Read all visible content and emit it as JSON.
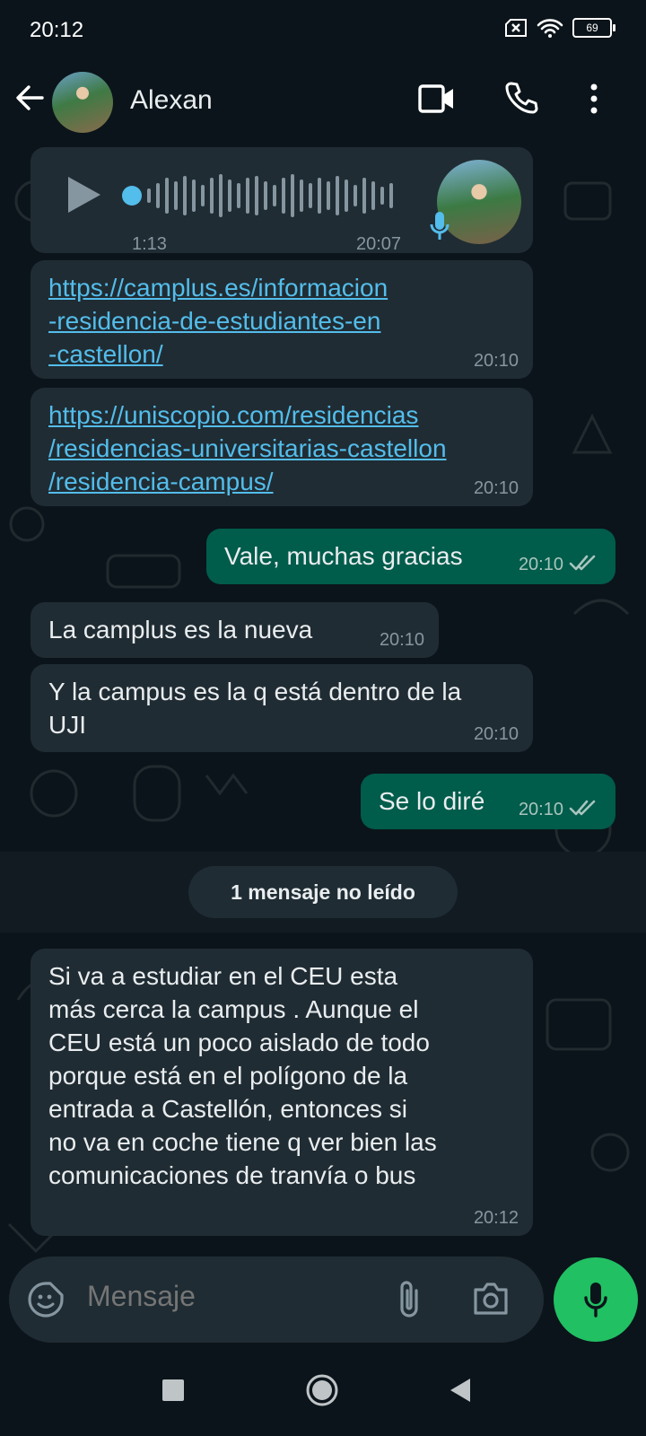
{
  "status_bar": {
    "time": "20:12",
    "battery": "69"
  },
  "header": {
    "contact_name": "Alexan"
  },
  "voice_message": {
    "duration": "1:13",
    "time": "20:07"
  },
  "messages": [
    {
      "lines": [
        "https://camplus.es/informacion",
        "-residencia-de-estudiantes-en",
        "-castellon/"
      ],
      "time": "20:10",
      "direction": "in"
    },
    {
      "lines": [
        "https://uniscopio.com/residencias",
        "/residencias-universitarias-castellon",
        "/residencia-campus/"
      ],
      "time": "20:10",
      "direction": "in"
    },
    {
      "text": "Vale, muchas gracias",
      "time": "20:10",
      "direction": "out"
    },
    {
      "text": "La camplus es la nueva",
      "time": "20:10",
      "direction": "in"
    },
    {
      "lines": [
        "Y la campus es la q está dentro de la",
        "UJI"
      ],
      "time": "20:10",
      "direction": "in"
    },
    {
      "text": "Se lo diré",
      "time": "20:10",
      "direction": "out"
    },
    {
      "lines": [
        "Si va a estudiar en el CEU esta",
        "más cerca la campus . Aunque el",
        "CEU está un poco aislado de todo",
        "porque está en el polígono de la",
        "entrada a Castellón, entonces si",
        "no va en coche tiene q ver bien las",
        "comunicaciones de tranvía o bus"
      ],
      "time": "20:12",
      "direction": "in"
    }
  ],
  "unread_banner": "1 mensaje no leído",
  "composer": {
    "placeholder": "Mensaje"
  },
  "colors": {
    "incoming": "#202c33",
    "outgoing": "#005c4b",
    "accent": "#21c063",
    "link": "#53bdeb",
    "background": "#0b141a"
  }
}
